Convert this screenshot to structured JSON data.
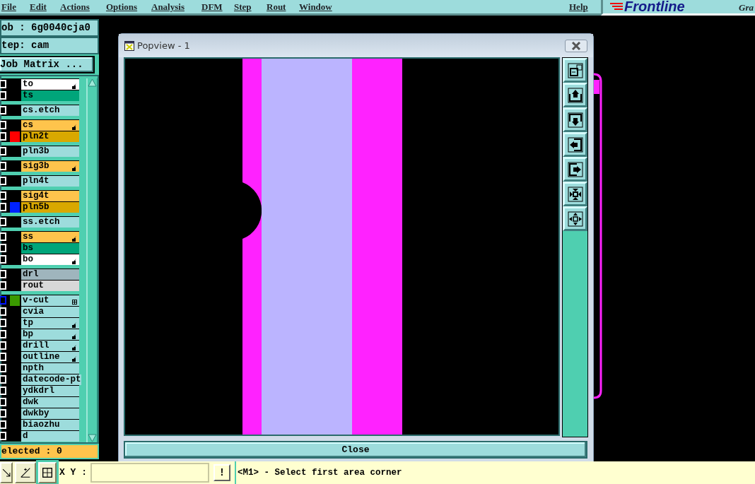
{
  "menu": [
    {
      "label": "File"
    },
    {
      "label": "Edit"
    },
    {
      "label": "Actions"
    },
    {
      "label": "Options"
    },
    {
      "label": "Analysis"
    },
    {
      "label": "DFM"
    },
    {
      "label": "Step"
    },
    {
      "label": "Rout"
    },
    {
      "label": "Window"
    }
  ],
  "help": "Help",
  "logo": {
    "brand": "Frontline",
    "tagline": "Gra"
  },
  "job_label": "ob : 6g0040cja0",
  "step_label": "tep: cam",
  "matrix_button": "Job Matrix ...",
  "layer_groups": [
    [
      {
        "name": "to",
        "color": "#ffffff",
        "hand": true,
        "linked": false,
        "focused": false
      },
      {
        "name": "ts",
        "color": "#00a57a",
        "hand": false,
        "linked": false,
        "focused": false
      }
    ],
    [
      {
        "name": "cs.etch",
        "color": "#9ddcdc",
        "hand": false,
        "linked": false,
        "focused": false
      }
    ],
    [
      {
        "name": "cs",
        "color": "#ffc44c",
        "hand": true,
        "linked": false,
        "focused": false
      },
      {
        "name": "pln2t",
        "color": "#d9a800",
        "swatch": {
          "color": "#ff0000"
        },
        "hand": false,
        "linked": false,
        "focused": false
      }
    ],
    [
      {
        "name": "pln3b",
        "color": "#9ddcdc",
        "hand": false,
        "linked": false,
        "focused": false
      }
    ],
    [
      {
        "name": "sig3b",
        "color": "#ffc44c",
        "hand": true,
        "linked": false,
        "focused": false
      }
    ],
    [
      {
        "name": "pln4t",
        "color": "#9ddcdc",
        "hand": false,
        "linked": false,
        "focused": false
      }
    ],
    [
      {
        "name": "sig4t",
        "color": "#ffc44c",
        "hand": false,
        "linked": false,
        "focused": false
      },
      {
        "name": "pln5b",
        "color": "#d9a800",
        "swatch": {
          "color": "#0022ff"
        },
        "hand": false,
        "linked": false,
        "focused": false
      }
    ],
    [
      {
        "name": "ss.etch",
        "color": "#9ddcdc",
        "hand": false,
        "linked": false,
        "focused": false
      }
    ],
    [
      {
        "name": "ss",
        "color": "#ffc44c",
        "hand": true,
        "linked": false,
        "focused": false
      },
      {
        "name": "bs",
        "color": "#00a57a",
        "hand": false,
        "linked": false,
        "focused": false
      },
      {
        "name": "bo",
        "color": "#ffffff",
        "hand": true,
        "linked": false,
        "focused": false
      }
    ],
    [
      {
        "name": "drl",
        "color": "#9fb5bd",
        "hand": false,
        "linked": false,
        "focused": false
      },
      {
        "name": "rout",
        "color": "#d8d8d8",
        "hand": false,
        "linked": false,
        "focused": false
      }
    ],
    [
      {
        "name": "v-cut",
        "color": "#9ddcdc",
        "swatch": {
          "color": "#3a9a00"
        },
        "hand": false,
        "linked": true,
        "focused": true
      },
      {
        "name": "cvia",
        "color": "#9ddcdc",
        "hand": false,
        "linked": false,
        "focused": false
      },
      {
        "name": "tp",
        "color": "#9ddcdc",
        "hand": true,
        "linked": false,
        "focused": false
      },
      {
        "name": "bp",
        "color": "#9ddcdc",
        "hand": true,
        "linked": false,
        "focused": false
      },
      {
        "name": "drill",
        "color": "#9ddcdc",
        "hand": true,
        "linked": false,
        "focused": false
      },
      {
        "name": "outline",
        "color": "#9ddcdc",
        "hand": true,
        "linked": false,
        "focused": false
      },
      {
        "name": "npth",
        "color": "#9ddcdc",
        "hand": false,
        "linked": false,
        "focused": false
      },
      {
        "name": "datecode-pt",
        "color": "#9ddcdc",
        "hand": false,
        "linked": false,
        "focused": false
      },
      {
        "name": "ydkdrl",
        "color": "#9ddcdc",
        "hand": false,
        "linked": false,
        "focused": false
      },
      {
        "name": "dwk",
        "color": "#9ddcdc",
        "hand": false,
        "linked": false,
        "focused": false
      },
      {
        "name": "dwkby",
        "color": "#9ddcdc",
        "hand": false,
        "linked": false,
        "focused": false
      },
      {
        "name": "biaozhu",
        "color": "#9ddcdc",
        "hand": false,
        "linked": false,
        "focused": false
      },
      {
        "name": "d",
        "color": "#9ddcdc",
        "hand": false,
        "linked": false,
        "focused": false
      }
    ]
  ],
  "selected_count": "elected : 0",
  "popview": {
    "title": "Popview - 1",
    "close_button": "Close",
    "tools": [
      {
        "kind": "zoom-home"
      },
      {
        "kind": "pan-up"
      },
      {
        "kind": "pan-down"
      },
      {
        "kind": "pan-left"
      },
      {
        "kind": "pan-right"
      },
      {
        "kind": "zoom-in"
      },
      {
        "kind": "zoom-out"
      }
    ]
  },
  "status": {
    "xy_label": "X Y :",
    "alert_button": "!",
    "message": "<M1> - Select first area corner"
  }
}
